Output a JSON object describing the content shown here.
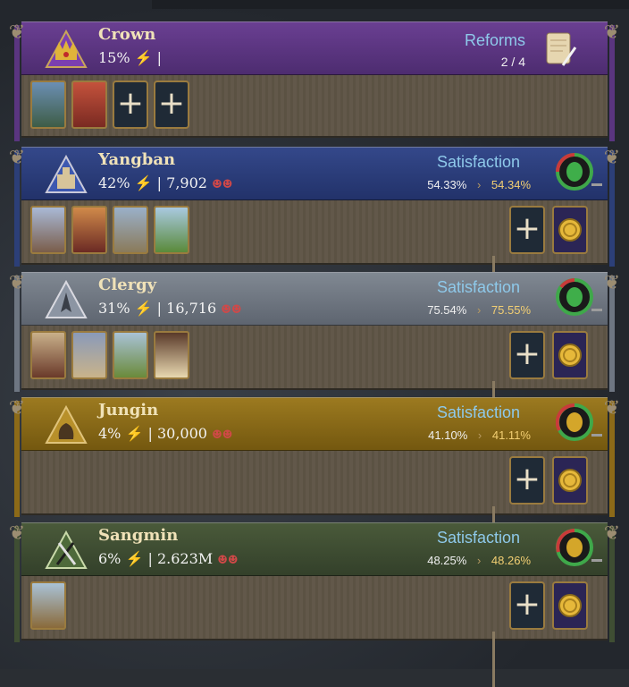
{
  "crown": {
    "name": "Crown",
    "share": "15%",
    "reforms_label": "Reforms",
    "reforms_count": "2 / 4"
  },
  "estates": [
    {
      "name": "Yangban",
      "share": "42%",
      "population": "7,902",
      "satisfaction_label": "Satisfaction",
      "sat_current": "54.33%",
      "sat_new": "54.34%",
      "header_color": "#2c3f78"
    },
    {
      "name": "Clergy",
      "share": "31%",
      "population": "16,716",
      "satisfaction_label": "Satisfaction",
      "sat_current": "75.54%",
      "sat_new": "75.55%",
      "header_color": "#6e7682"
    },
    {
      "name": "Jungin",
      "share": "4%",
      "population": "30,000",
      "satisfaction_label": "Satisfaction",
      "sat_current": "41.10%",
      "sat_new": "41.11%",
      "header_color": "#8c6a18"
    },
    {
      "name": "Sangmin",
      "share": "6%",
      "population": "2.623M",
      "satisfaction_label": "Satisfaction",
      "sat_current": "48.25%",
      "sat_new": "48.26%",
      "header_color": "#3f4e33"
    }
  ],
  "glyphs": {
    "bolt": "⚡",
    "sep": "|",
    "arrow": "›",
    "plus": "+"
  },
  "colors": {
    "crown": "#5a3580",
    "gold_border": "#9a7b3f",
    "accent_blue": "#8ec9ea"
  }
}
